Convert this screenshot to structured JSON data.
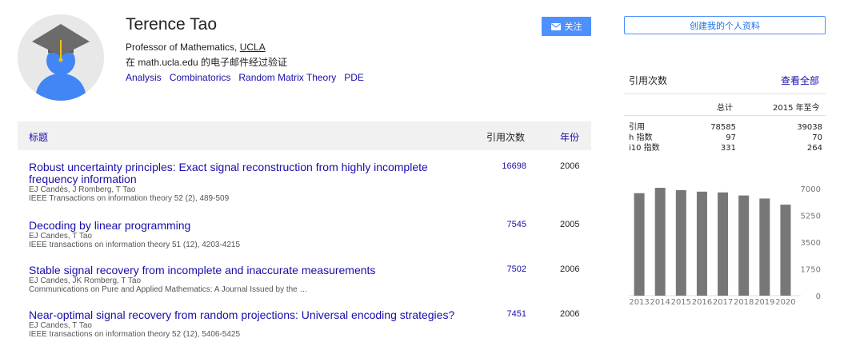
{
  "profile": {
    "name": "Terence Tao",
    "affiliation_prefix": "Professor of Mathematics, ",
    "affiliation_link": "UCLA",
    "verified": "在 math.ucla.edu 的电子邮件经过验证",
    "interests": [
      "Analysis",
      "Combinatorics",
      "Random Matrix Theory",
      "PDE"
    ],
    "follow_label": "关注",
    "create_label": "创建我的个人资料"
  },
  "colors": {
    "link": "#1a0dab",
    "button": "#4d90fe",
    "bar": "#777777"
  },
  "table": {
    "col_title": "标题",
    "col_cited": "引用次数",
    "col_year": "年份",
    "articles": [
      {
        "title": "Robust uncertainty principles: Exact signal reconstruction from highly incomplete frequency information",
        "authors": "EJ Candès, J Romberg, T Tao",
        "venue": "IEEE Transactions on information theory 52 (2), 489-509",
        "cited": "16698",
        "year": "2006"
      },
      {
        "title": "Decoding by linear programming",
        "authors": "EJ Candes, T Tao",
        "venue": "IEEE transactions on information theory 51 (12), 4203-4215",
        "cited": "7545",
        "year": "2005"
      },
      {
        "title": "Stable signal recovery from incomplete and inaccurate measurements",
        "authors": "EJ Candes, JK Romberg, T Tao",
        "venue": "Communications on Pure and Applied Mathematics: A Journal Issued by the …",
        "cited": "7502",
        "year": "2006"
      },
      {
        "title": "Near-optimal signal recovery from random projections: Universal encoding strategies?",
        "authors": "EJ Candes, T Tao",
        "venue": "IEEE transactions on information theory 52 (12), 5406-5425",
        "cited": "7451",
        "year": "2006"
      }
    ]
  },
  "citations": {
    "heading": "引用次数",
    "view_all": "查看全部",
    "col_total": "总计",
    "col_since": "2015 年至今",
    "rows": [
      {
        "label": "引用",
        "total": "78585",
        "since": "39038"
      },
      {
        "label": "h 指数",
        "total": "97",
        "since": "70"
      },
      {
        "label": "i10 指数",
        "total": "331",
        "since": "264"
      }
    ]
  },
  "chart_data": {
    "type": "bar",
    "categories": [
      "2013",
      "2014",
      "2015",
      "2016",
      "2017",
      "2018",
      "2019",
      "2020"
    ],
    "values": [
      6700,
      7050,
      6900,
      6800,
      6750,
      6550,
      6350,
      5950
    ],
    "yticks": [
      "7000",
      "5250",
      "3500",
      "1750",
      "0"
    ],
    "ylim": [
      0,
      7000
    ]
  }
}
